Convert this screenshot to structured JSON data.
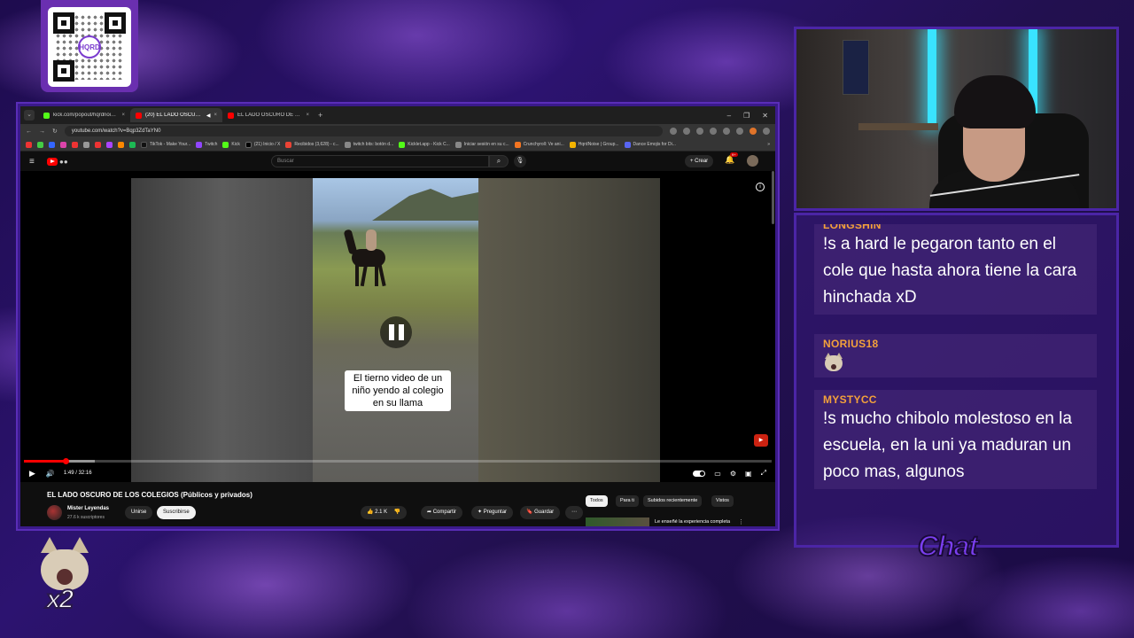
{
  "browser": {
    "tabs": [
      {
        "label": "kick.com/popout/hqrdnoise/ch",
        "color": "#53fc18",
        "active": false
      },
      {
        "label": "(20) EL LADO OSCURO DE",
        "color": "#ff0000",
        "active": true
      },
      {
        "label": "EL LADO OSCURO DE LOS CO",
        "color": "#ff0000",
        "active": false
      }
    ],
    "url": "youtube.com/watch?v=Bqp3ZdTaYN0",
    "bookmarks": [
      {
        "label": "TikTok - Make Your...",
        "color": "#111111"
      },
      {
        "label": "Twitch",
        "color": "#9146ff"
      },
      {
        "label": "Kick",
        "color": "#53fc18"
      },
      {
        "label": "(21) Inicio / X",
        "color": "#000000"
      },
      {
        "label": "Recibidos (3,628) - c...",
        "color": "#ea4335"
      },
      {
        "label": "twitch bits: botón d...",
        "color": "#888888"
      },
      {
        "label": "Kicklet.app - Kick C...",
        "color": "#53fc18"
      },
      {
        "label": "Iniciar sesión en su c...",
        "color": "#888888"
      },
      {
        "label": "Crunchyroll: Ve ani...",
        "color": "#f47521"
      },
      {
        "label": "HqrdNoise | Group...",
        "color": "#f4b400"
      },
      {
        "label": "Dance Emojis for Di...",
        "color": "#5865f2"
      }
    ]
  },
  "youtube": {
    "search_placeholder": "Buscar",
    "create_label": "Crear",
    "notifications": "9+",
    "caption": "El tierno video de un niño yendo al colegio en su llama",
    "time": "1:49 / 32:16",
    "progress": {
      "played_fraction": 0.056,
      "loaded_fraction": 0.095
    },
    "video_title": "EL LADO OSCURO DE LOS COLEGIOS (Públicos y privados)",
    "channel_name": "Mister Leyendas",
    "channel_subs": "27.6 k suscriptores",
    "join_label": "Unirse",
    "subscribe_label": "Suscribirse",
    "likes": "2.1 K",
    "share_label": "Compartir",
    "ask_label": "Preguntar",
    "save_label": "Guardar",
    "chips": [
      "Todos",
      "Para ti",
      "Subidos recientemente",
      "Vistos"
    ],
    "recommendation_title": "Le enseñé la experiencia completa de tod..."
  },
  "chat": {
    "messages": [
      {
        "user": "LONGSHIN",
        "text": "!s a hard le pegaron tanto en el cole que hasta ahora tiene la cara hinchada xD"
      },
      {
        "user": "NORIUS18",
        "text": "",
        "emote": "cat-emote"
      },
      {
        "user": "MYSTYCC",
        "text": "!s mucho chibolo molestoso en la escuela, en la uni ya maduran un poco mas, algunos"
      }
    ],
    "title": "Chat",
    "username_color": "#f3a13b"
  },
  "overlay": {
    "qr_logo": "HQRD",
    "multiplier": "x2"
  }
}
